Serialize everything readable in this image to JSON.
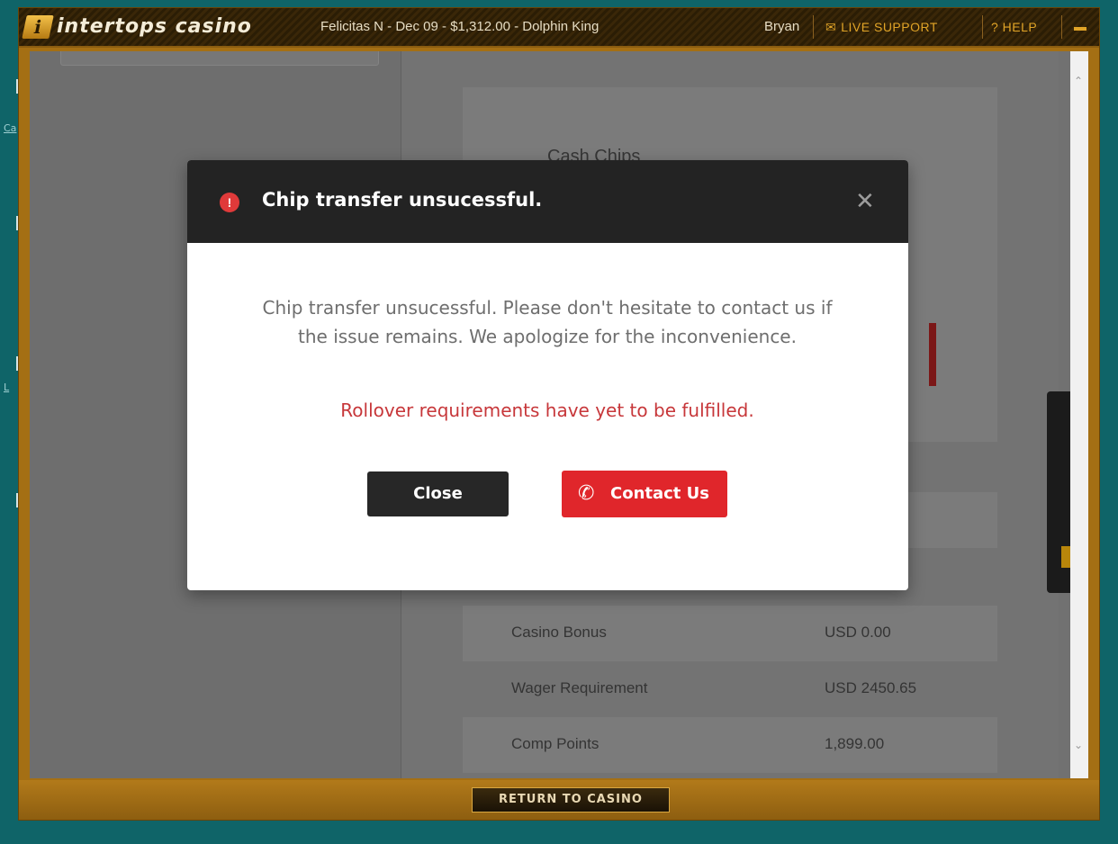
{
  "left_fragments": [
    "Ca",
    "L"
  ],
  "topbar": {
    "brand": "intertops casino",
    "ticker": "Felicitas N - Dec 09 - $1,312.00 - Dolphin King",
    "user": "Bryan",
    "live_support": "LIVE SUPPORT",
    "help": "? HELP"
  },
  "background": {
    "cash_chips_title": "Cash Chips",
    "partial_value": "11",
    "rows": [
      {
        "label": "Casino Bonus",
        "value": "USD 0.00"
      },
      {
        "label": "Wager Requirement",
        "value": "USD 2450.65"
      },
      {
        "label": "Comp Points",
        "value": "1,899.00"
      }
    ]
  },
  "modal": {
    "title": "Chip transfer unsucessful.",
    "message": "Chip transfer unsucessful. Please don't hesitate to contact us if the issue remains. We apologize for the inconvenience.",
    "warning": "Rollover requirements have yet to be fulfilled.",
    "close_label": "Close",
    "contact_label": "Contact Us"
  },
  "footer": {
    "return_label": "RETURN TO CASINO"
  },
  "colors": {
    "page_bg": "#0f6468",
    "gold": "#a46f14",
    "danger": "#e0262b",
    "warning_text": "#c7373a"
  }
}
